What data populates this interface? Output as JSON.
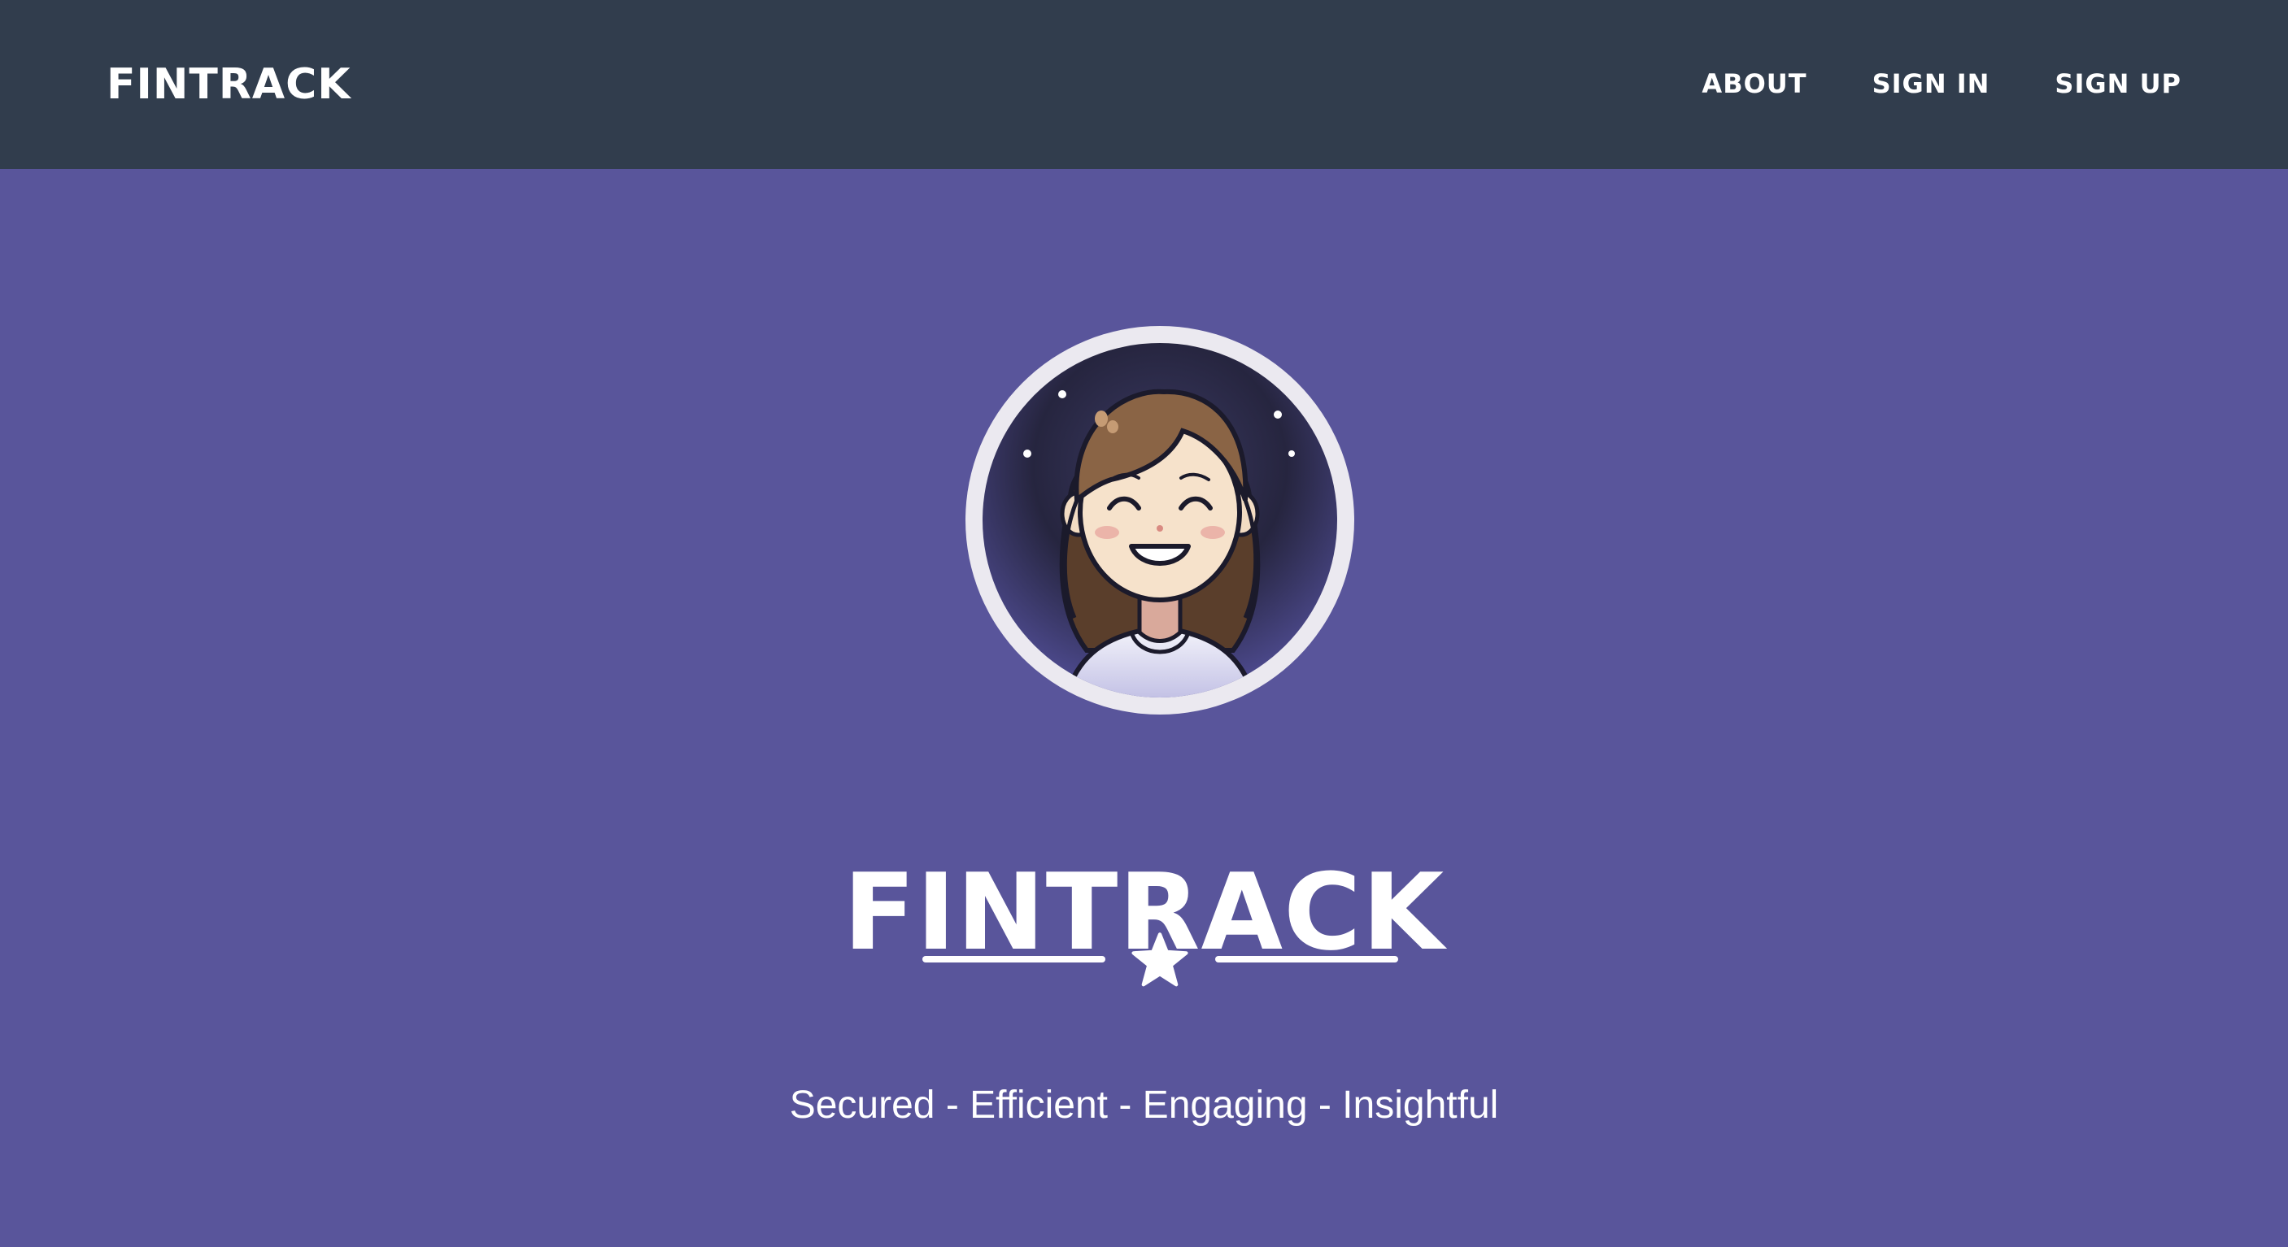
{
  "navbar": {
    "brand": "FINTRACK",
    "links": [
      {
        "label": "ABOUT"
      },
      {
        "label": "SIGN IN"
      },
      {
        "label": "SIGN UP"
      }
    ]
  },
  "hero": {
    "avatar_icon": "smiling-girl-avatar",
    "title": "FINTRACK",
    "divider_icon": "star-icon",
    "tagline": "Secured - Efficient - Engaging - Insightful"
  },
  "colors": {
    "navbar_bg": "#313d4d",
    "hero_bg": "#59559b",
    "text": "#ffffff",
    "avatar_ring": "#ebe9f0"
  }
}
